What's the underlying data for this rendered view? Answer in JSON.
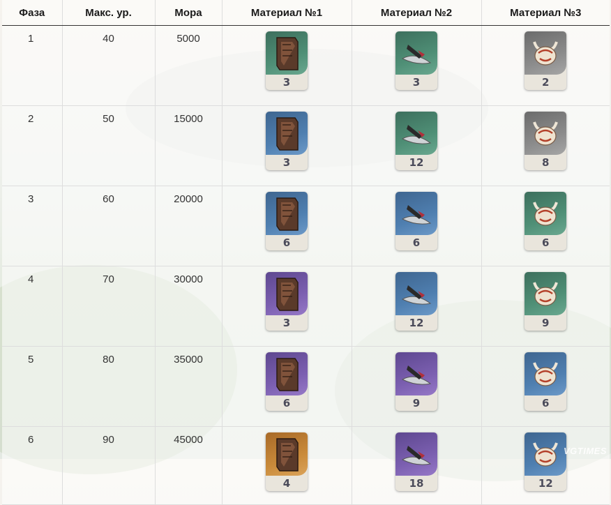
{
  "colors": {
    "green": "#4f8f76",
    "gray": "#8b8b8b",
    "blue": "#4f7fb0",
    "purple": "#7b5fb0",
    "orange": "#c98a3a"
  },
  "headers": [
    "Фаза",
    "Макс. ур.",
    "Мора",
    "Материал №1",
    "Материал №2",
    "Материал №3"
  ],
  "rows": [
    {
      "phase": "1",
      "level": "40",
      "mora": "5000",
      "m1": {
        "icon": "box-icon",
        "rarity": "green",
        "count": "3"
      },
      "m2": {
        "icon": "weapon-blade-icon",
        "rarity": "green",
        "count": "3"
      },
      "m3": {
        "icon": "horned-mask-icon",
        "rarity": "gray",
        "count": "2"
      }
    },
    {
      "phase": "2",
      "level": "50",
      "mora": "15000",
      "m1": {
        "icon": "box-icon",
        "rarity": "blue",
        "count": "3"
      },
      "m2": {
        "icon": "weapon-blade-icon",
        "rarity": "green",
        "count": "12"
      },
      "m3": {
        "icon": "horned-mask-icon",
        "rarity": "gray",
        "count": "8"
      }
    },
    {
      "phase": "3",
      "level": "60",
      "mora": "20000",
      "m1": {
        "icon": "box-icon",
        "rarity": "blue",
        "count": "6"
      },
      "m2": {
        "icon": "weapon-blade-icon",
        "rarity": "blue",
        "count": "6"
      },
      "m3": {
        "icon": "horned-mask-icon",
        "rarity": "green",
        "count": "6"
      }
    },
    {
      "phase": "4",
      "level": "70",
      "mora": "30000",
      "m1": {
        "icon": "box-icon",
        "rarity": "purple",
        "count": "3"
      },
      "m2": {
        "icon": "weapon-blade-icon",
        "rarity": "blue",
        "count": "12"
      },
      "m3": {
        "icon": "horned-mask-icon",
        "rarity": "green",
        "count": "9"
      }
    },
    {
      "phase": "5",
      "level": "80",
      "mora": "35000",
      "m1": {
        "icon": "box-icon",
        "rarity": "purple",
        "count": "6"
      },
      "m2": {
        "icon": "weapon-blade-icon",
        "rarity": "purple",
        "count": "9"
      },
      "m3": {
        "icon": "horned-mask-icon",
        "rarity": "blue",
        "count": "6"
      }
    },
    {
      "phase": "6",
      "level": "90",
      "mora": "45000",
      "m1": {
        "icon": "box-icon",
        "rarity": "orange",
        "count": "4"
      },
      "m2": {
        "icon": "weapon-blade-icon",
        "rarity": "purple",
        "count": "18"
      },
      "m3": {
        "icon": "horned-mask-icon",
        "rarity": "blue",
        "count": "12"
      }
    }
  ],
  "watermark": "VGTIMES"
}
